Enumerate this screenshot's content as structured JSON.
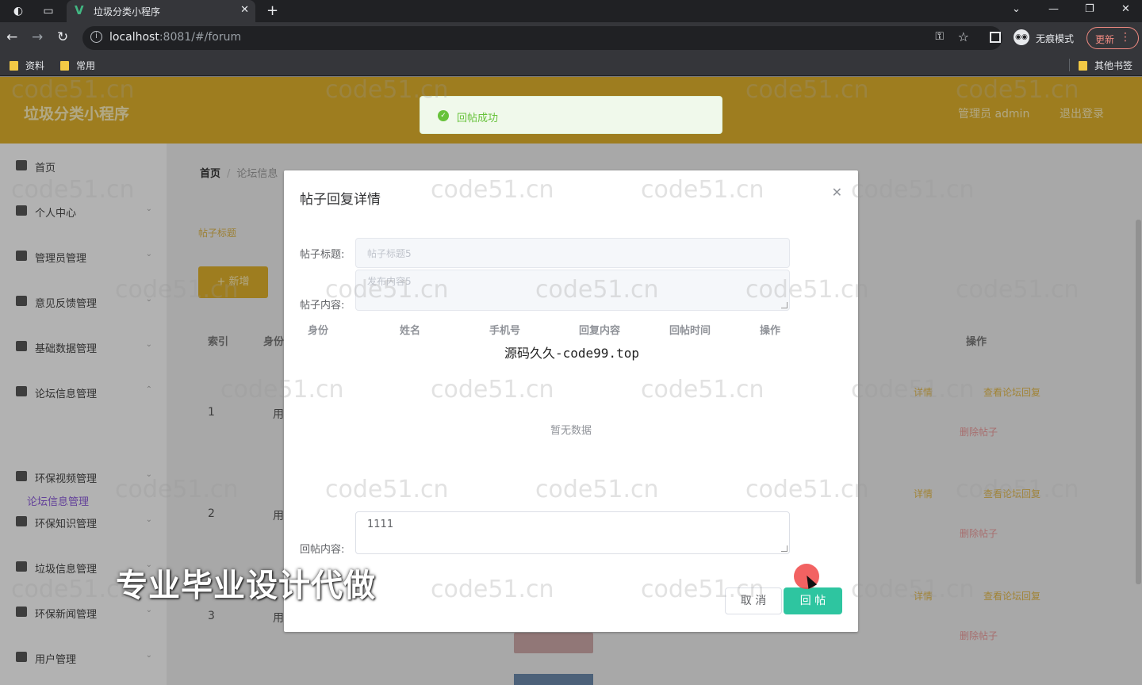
{
  "browser": {
    "tab_title": "垃圾分类小程序",
    "url_host": "localhost",
    "url_rest": ":8081/#/forum",
    "profile_label": "无痕模式",
    "update_label": "更新",
    "bookmarks": [
      "资料",
      "常用"
    ],
    "other_bookmarks": "其他书签"
  },
  "app": {
    "title": "垃圾分类小程序",
    "user_label": "管理员 admin",
    "logout_label": "退出登录",
    "sidebar": [
      {
        "label": "首页",
        "icon": "home-icon"
      },
      {
        "label": "个人中心",
        "icon": "user-icon"
      },
      {
        "label": "管理员管理",
        "icon": "phone-icon"
      },
      {
        "label": "意见反馈管理",
        "icon": "copy-icon"
      },
      {
        "label": "基础数据管理",
        "icon": "grid-icon"
      },
      {
        "label": "论坛信息管理",
        "icon": "chat-icon"
      },
      {
        "label": "环保视频管理",
        "icon": "flag-icon"
      },
      {
        "label": "环保知识管理",
        "icon": "list-icon"
      },
      {
        "label": "垃圾信息管理",
        "icon": "bars-icon"
      },
      {
        "label": "环保新闻管理",
        "icon": "location-icon"
      },
      {
        "label": "用户管理",
        "icon": "chat-icon"
      }
    ],
    "sidebar_sub": "论坛信息管理",
    "breadcrumb": {
      "home": "首页",
      "current": "论坛信息"
    },
    "search_label": "帖子标题",
    "add_label": "+ 新增",
    "columns": {
      "index": "索引",
      "identity": "身份",
      "ops": "操作"
    },
    "rows": [
      {
        "index": "1",
        "identity": "用"
      },
      {
        "index": "2",
        "identity": "用"
      },
      {
        "index": "3",
        "identity": "用"
      }
    ],
    "row_actions": {
      "detail": "详情",
      "view_reply": "查看论坛回复",
      "delete": "删除帖子"
    }
  },
  "toast": {
    "message": "回帖成功"
  },
  "dialog": {
    "title": "帖子回复详情",
    "post_title_label": "帖子标题:",
    "post_title_value": "帖子标题5",
    "post_content_label": "帖子内容:",
    "post_content_value": "发布内容5",
    "columns": [
      "身份",
      "姓名",
      "手机号",
      "回复内容",
      "回帖时间",
      "操作"
    ],
    "empty_text": "暂无数据",
    "reply_label": "回帖内容:",
    "reply_value": "1111",
    "cancel_label": "取 消",
    "submit_label": "回 帖"
  },
  "overlay_texts": {
    "center": "源码久久-code99.top",
    "promo": "专业毕业设计代做",
    "watermark": "code51.cn"
  },
  "colors": {
    "accent": "#dcae2c",
    "success": "#67c23a",
    "submit": "#2ec5a0"
  }
}
